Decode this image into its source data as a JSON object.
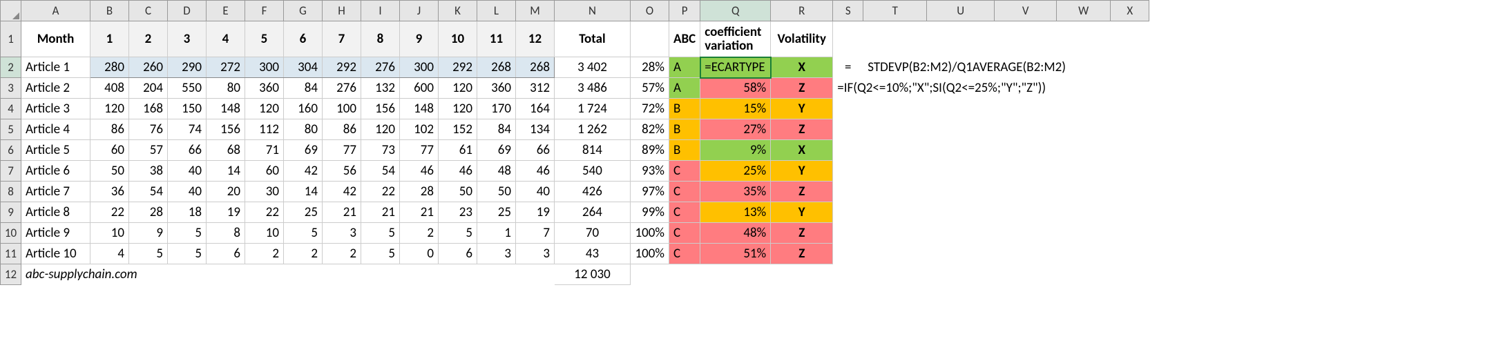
{
  "colHeaders": [
    "A",
    "B",
    "C",
    "D",
    "E",
    "F",
    "G",
    "H",
    "I",
    "J",
    "K",
    "L",
    "M",
    "N",
    "O",
    "P",
    "Q",
    "R",
    "S",
    "T",
    "U",
    "V",
    "W",
    "X"
  ],
  "rowHeaders": [
    "1",
    "2",
    "3",
    "4",
    "5",
    "6",
    "7",
    "8",
    "9",
    "10",
    "11",
    "12"
  ],
  "activeCol": "Q",
  "activeRow": "2",
  "header": {
    "month": "Month",
    "months": [
      "1",
      "2",
      "3",
      "4",
      "5",
      "6",
      "7",
      "8",
      "9",
      "10",
      "11",
      "12"
    ],
    "total": "Total",
    "abc": "ABC",
    "cv_line1": "coefficient",
    "cv_line2": "variation",
    "vol": "Volatility"
  },
  "rows": [
    {
      "name": "Article 1",
      "v": [
        280,
        260,
        290,
        272,
        300,
        304,
        292,
        276,
        300,
        292,
        268,
        268
      ],
      "total": "3 402",
      "pct": "28%",
      "abc": "A",
      "cv": "=ECARTYPE",
      "cvCls": "cv-low",
      "vol": "X",
      "sel": true,
      "active": true
    },
    {
      "name": "Article 2",
      "v": [
        408,
        204,
        550,
        80,
        360,
        84,
        276,
        132,
        600,
        120,
        360,
        312
      ],
      "total": "3 486",
      "pct": "57%",
      "abc": "A",
      "cv": "58%",
      "cvCls": "cv-high",
      "vol": "Z"
    },
    {
      "name": "Article 3",
      "v": [
        120,
        168,
        150,
        148,
        120,
        160,
        100,
        156,
        148,
        120,
        170,
        164
      ],
      "total": "1 724",
      "pct": "72%",
      "abc": "B",
      "cv": "15%",
      "cvCls": "cv-mid",
      "vol": "Y"
    },
    {
      "name": "Article 4",
      "v": [
        86,
        76,
        74,
        156,
        112,
        80,
        86,
        120,
        102,
        152,
        84,
        134
      ],
      "total": "1 262",
      "pct": "82%",
      "abc": "B",
      "cv": "27%",
      "cvCls": "cv-high",
      "vol": "Z"
    },
    {
      "name": "Article 5",
      "v": [
        60,
        57,
        66,
        68,
        71,
        69,
        77,
        73,
        77,
        61,
        69,
        66
      ],
      "total": "814",
      "pct": "89%",
      "abc": "B",
      "cv": "9%",
      "cvCls": "cv-low",
      "vol": "X"
    },
    {
      "name": "Article 6",
      "v": [
        50,
        38,
        40,
        14,
        60,
        42,
        56,
        54,
        46,
        46,
        48,
        46
      ],
      "total": "540",
      "pct": "93%",
      "abc": "C",
      "cv": "25%",
      "cvCls": "cv-mid",
      "vol": "Y"
    },
    {
      "name": "Article 7",
      "v": [
        36,
        54,
        40,
        20,
        30,
        14,
        42,
        22,
        28,
        50,
        50,
        40
      ],
      "total": "426",
      "pct": "97%",
      "abc": "C",
      "cv": "35%",
      "cvCls": "cv-high",
      "vol": "Z"
    },
    {
      "name": "Article 8",
      "v": [
        22,
        28,
        18,
        19,
        22,
        25,
        21,
        21,
        21,
        23,
        25,
        19
      ],
      "total": "264",
      "pct": "99%",
      "abc": "C",
      "cv": "13%",
      "cvCls": "cv-mid",
      "vol": "Y"
    },
    {
      "name": "Article 9",
      "v": [
        10,
        9,
        5,
        8,
        10,
        5,
        3,
        5,
        2,
        5,
        1,
        7
      ],
      "total": "70",
      "pct": "100%",
      "abc": "C",
      "cv": "48%",
      "cvCls": "cv-high",
      "vol": "Z"
    },
    {
      "name": "Article 10",
      "v": [
        4,
        5,
        5,
        6,
        2,
        2,
        2,
        5,
        0,
        6,
        3,
        3
      ],
      "total": "43",
      "pct": "100%",
      "abc": "C",
      "cv": "51%",
      "cvCls": "cv-high",
      "vol": "Z"
    }
  ],
  "footer": {
    "label": "abc-supplychain.com",
    "total": "12 030"
  },
  "formulas": {
    "eq": "=",
    "r2a": "STDEVP",
    "r2b": "(B2:M2)/Q1",
    "r2c": "AVERAGE",
    "r2d": "(B2:M2)",
    "r3": "=IF(Q2<=10%;\"X\";SI(Q2<=25%;\"Y\";\"Z\"))"
  },
  "colWidths": {
    "rowhdr": 30,
    "A": 100,
    "B": 56,
    "C": 56,
    "D": 56,
    "E": 56,
    "F": 56,
    "G": 56,
    "H": 56,
    "I": 56,
    "J": 56,
    "K": 56,
    "L": 56,
    "M": 56,
    "N": 110,
    "O": 56,
    "P": 44,
    "Q": 102,
    "R": 90,
    "S": 44,
    "T": 92,
    "U": 98,
    "V": 90,
    "W": 78,
    "X": 56
  }
}
